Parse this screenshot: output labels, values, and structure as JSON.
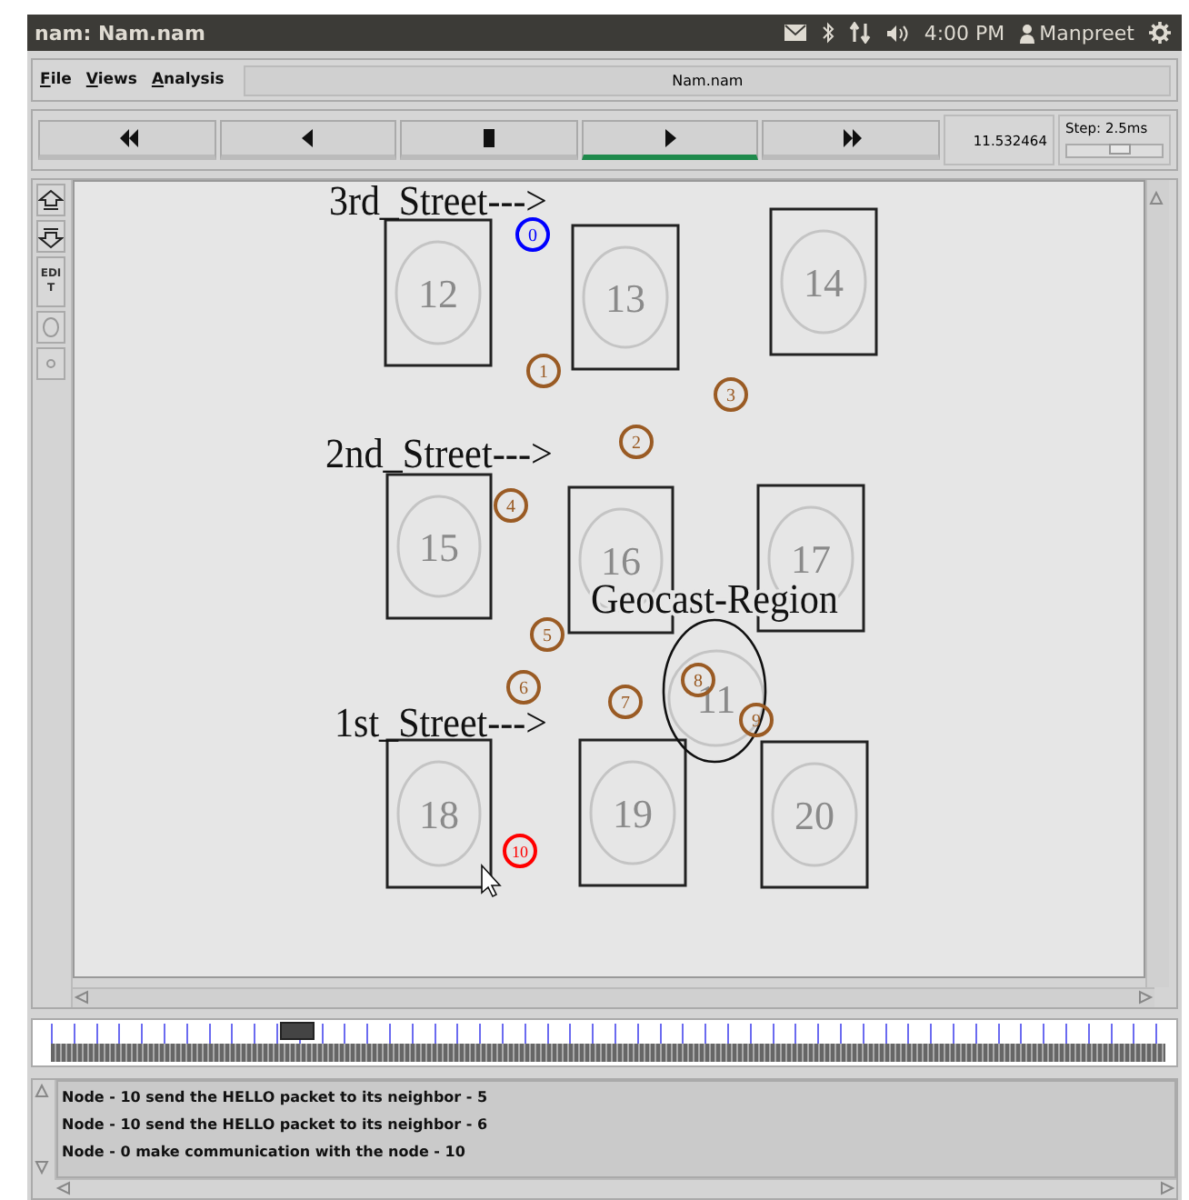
{
  "window": {
    "title": "nam: Nam.nam"
  },
  "panel": {
    "clock": "4:00 PM",
    "user": "Manpreet"
  },
  "menu": [
    {
      "label": "File"
    },
    {
      "label": "Views"
    },
    {
      "label": "Analysis"
    }
  ],
  "file_field": {
    "value": "Nam.nam"
  },
  "playback_buttons": [
    {
      "kind": "fast-rewind",
      "selected": false
    },
    {
      "kind": "back",
      "selected": false
    },
    {
      "kind": "stop",
      "selected": false
    },
    {
      "kind": "play",
      "selected": true
    },
    {
      "kind": "fast-forward",
      "selected": false
    }
  ],
  "time": "11.532464",
  "step": {
    "label": "Step: 2.5ms",
    "level": 0.55
  },
  "side_tools": [
    {
      "kind": "zoom-in"
    },
    {
      "kind": "zoom-out"
    },
    {
      "kind": "text",
      "label": "EDIT"
    },
    {
      "kind": "circle"
    },
    {
      "kind": "dot"
    }
  ],
  "canvas": {
    "street_labels": [
      "3rd_Street--->",
      "2nd_Street--->",
      "1st_Street--->"
    ],
    "region": {
      "label": "Geocast-Region",
      "center_node": "11"
    },
    "buildings": [
      "12",
      "13",
      "14",
      "15",
      "16",
      "17",
      "18",
      "19",
      "20"
    ],
    "nodes": [
      {
        "label": "0",
        "color": "#0000ff"
      },
      {
        "label": "1",
        "color": "#9a5b24"
      },
      {
        "label": "2",
        "color": "#9a5b24"
      },
      {
        "label": "3",
        "color": "#9a5b24"
      },
      {
        "label": "4",
        "color": "#9a5b24"
      },
      {
        "label": "5",
        "color": "#9a5b24"
      },
      {
        "label": "6",
        "color": "#9a5b24"
      },
      {
        "label": "7",
        "color": "#9a5b24"
      },
      {
        "label": "8",
        "color": "#9a5b24"
      },
      {
        "label": "9",
        "color": "#9a5b24"
      },
      {
        "label": "10",
        "color": "#ff0000"
      }
    ]
  },
  "log": [
    "Node - 10 send the HELLO packet to its neighbor - 5",
    "Node - 10 send the HELLO packet to its neighbor - 6",
    "Node - 0 make communication with the node - 10"
  ]
}
